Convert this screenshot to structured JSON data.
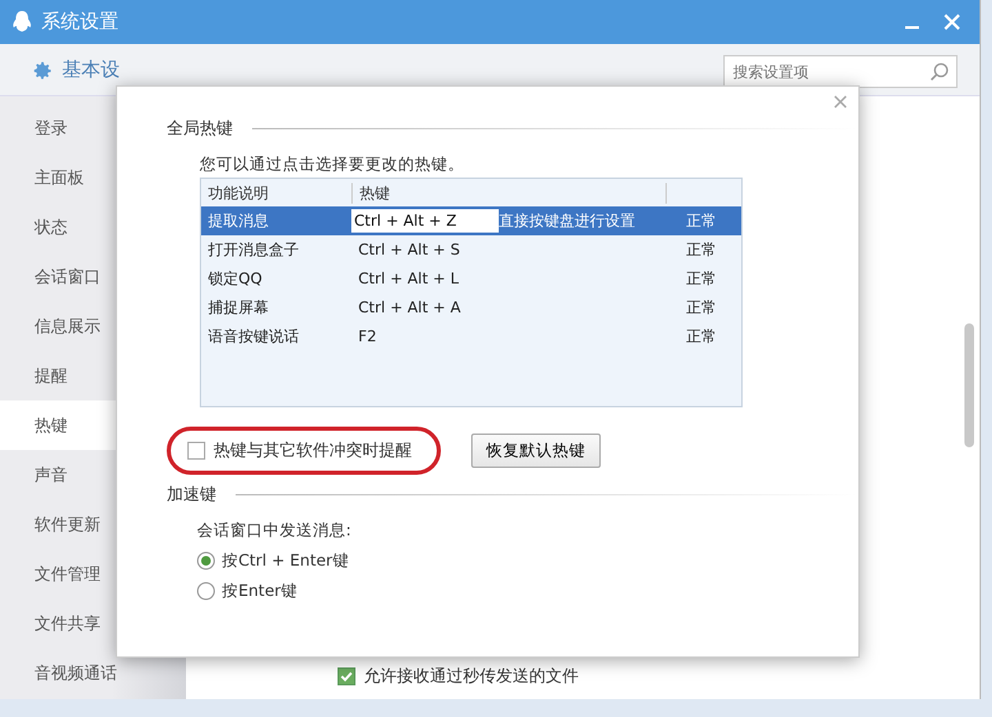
{
  "window": {
    "title": "系统设置"
  },
  "toolbar": {
    "tabs": [
      {
        "label": "基本设",
        "selected": true
      }
    ],
    "search": {
      "placeholder": "搜索设置项"
    }
  },
  "sidebar": {
    "items": [
      {
        "label": "登录",
        "selected": false
      },
      {
        "label": "主面板",
        "selected": false
      },
      {
        "label": "状态",
        "selected": false
      },
      {
        "label": "会话窗口",
        "selected": false
      },
      {
        "label": "信息展示",
        "selected": false
      },
      {
        "label": "提醒",
        "selected": false
      },
      {
        "label": "热键",
        "selected": true
      },
      {
        "label": "声音",
        "selected": false
      },
      {
        "label": "软件更新",
        "selected": false
      },
      {
        "label": "文件管理",
        "selected": false
      },
      {
        "label": "文件共享",
        "selected": false
      },
      {
        "label": "音视频通话",
        "selected": false
      }
    ]
  },
  "background_option": {
    "label": "允许接收通过秒传发送的文件",
    "checked": true
  },
  "dialog": {
    "global_hotkeys": {
      "title": "全局热键",
      "hint": "您可以通过点击选择要更改的热键。",
      "table": {
        "columns": [
          "功能说明",
          "热键"
        ],
        "rows": [
          {
            "function": "提取消息",
            "hotkey": "Ctrl + Alt + Z",
            "note": "直接按键盘进行设置",
            "status": "正常",
            "selected": true
          },
          {
            "function": "打开消息盒子",
            "hotkey": "Ctrl + Alt + S",
            "status": "正常",
            "selected": false
          },
          {
            "function": "锁定QQ",
            "hotkey": "Ctrl + Alt + L",
            "status": "正常",
            "selected": false
          },
          {
            "function": "捕捉屏幕",
            "hotkey": "Ctrl + Alt + A",
            "status": "正常",
            "selected": false
          },
          {
            "function": "语音按键说话",
            "hotkey": "F2",
            "status": "正常",
            "selected": false
          }
        ]
      },
      "conflict_option": {
        "label": "热键与其它软件冲突时提醒",
        "checked": false
      },
      "restore_button": "恢复默认热键"
    },
    "accelerator": {
      "title": "加速键",
      "prompt": "会话窗口中发送消息:",
      "options": [
        {
          "label": "按Ctrl + Enter键",
          "selected": true
        },
        {
          "label": "按Enter键",
          "selected": false
        }
      ]
    }
  }
}
